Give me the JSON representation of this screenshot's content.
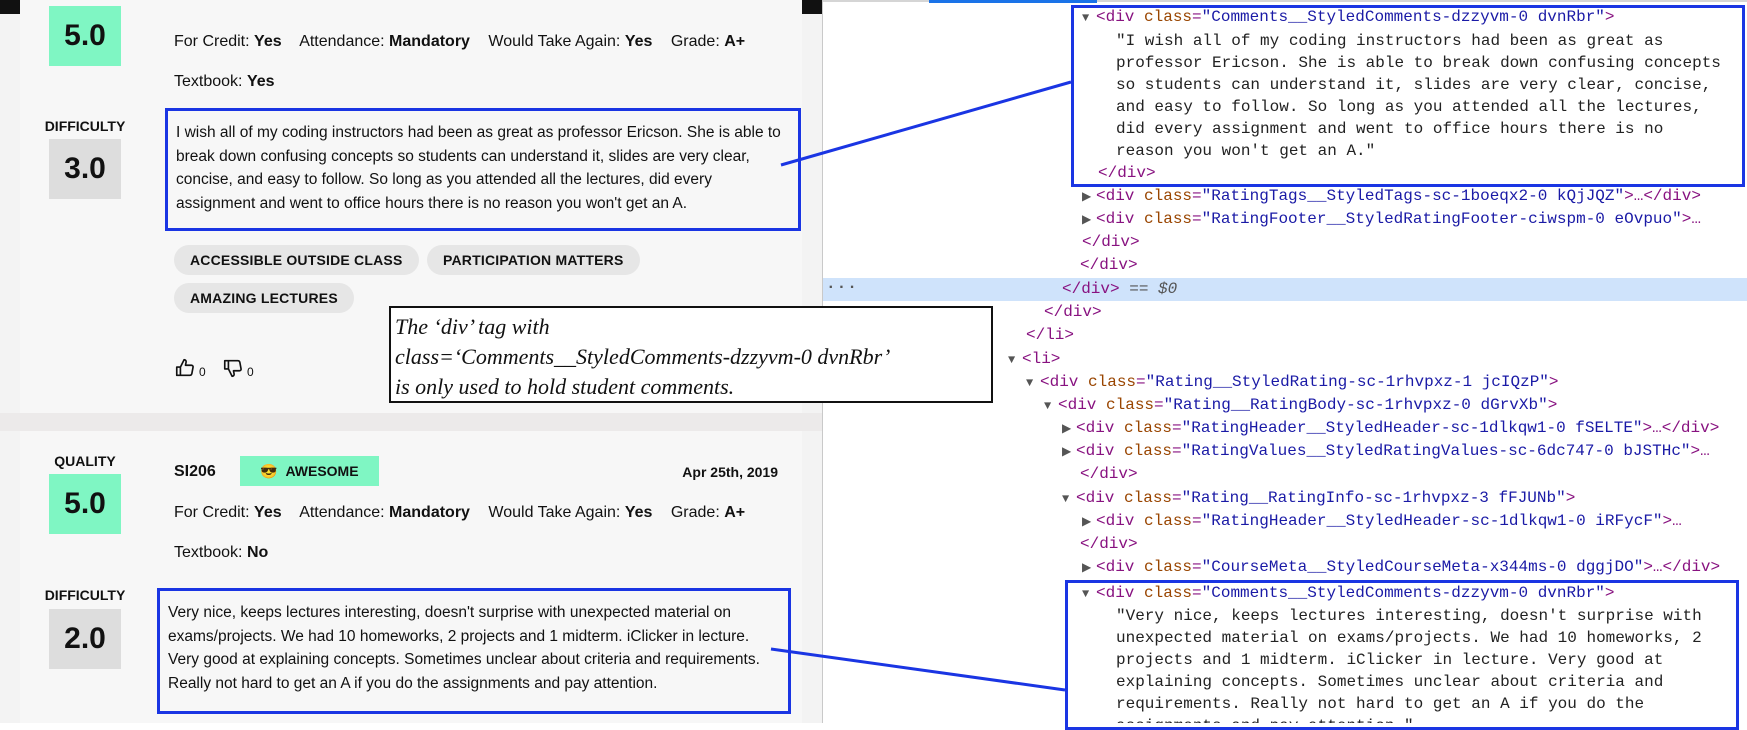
{
  "review1": {
    "quality_score": "5.0",
    "difficulty_label": "DIFFICULTY",
    "difficulty_score": "3.0",
    "meta": [
      {
        "label": "For Credit:",
        "value": "Yes"
      },
      {
        "label": "Attendance:",
        "value": "Mandatory"
      },
      {
        "label": "Would Take Again:",
        "value": "Yes"
      },
      {
        "label": "Grade:",
        "value": "A+"
      }
    ],
    "textbook_label": "Textbook:",
    "textbook_value": "Yes",
    "comment": "I wish all of my coding instructors had been as great as professor Ericson. She is able to break down confusing concepts so students can understand it, slides are very clear, concise, and easy to follow. So long as you attended all the lectures, did every assignment and went to office hours there is no reason you won't get an A.",
    "tags": [
      "ACCESSIBLE OUTSIDE CLASS",
      "PARTICIPATION MATTERS",
      "AMAZING LECTURES"
    ],
    "thumbs_up": "0",
    "thumbs_down": "0"
  },
  "review2": {
    "quality_label": "QUALITY",
    "quality_score": "5.0",
    "course": "SI206",
    "badge_emoji": "😎",
    "badge": "AWESOME",
    "date": "Apr 25th, 2019",
    "difficulty_label": "DIFFICULTY",
    "difficulty_score": "2.0",
    "meta": [
      {
        "label": "For Credit:",
        "value": "Yes"
      },
      {
        "label": "Attendance:",
        "value": "Mandatory"
      },
      {
        "label": "Would Take Again:",
        "value": "Yes"
      },
      {
        "label": "Grade:",
        "value": "A+"
      }
    ],
    "textbook_label": "Textbook:",
    "textbook_value": "No",
    "comment": "Very nice, keeps lectures interesting, doesn't surprise with unexpected material on exams/projects. We had 10 homeworks, 2 projects and 1 midterm. iClicker in lecture. Very good at explaining concepts. Sometimes unclear about criteria and requirements. Really not hard to get an A if you do the assignments and pay attention."
  },
  "annotation": {
    "line1": "The ‘div’ tag with",
    "line2": "class=‘Comments__StyledComments-dzzyvm-0 dvnRbr’",
    "line3": "is only used to hold student comments."
  },
  "devtools": {
    "comment1_text": "\"I wish all of my coding instructors had been as great as\nprofessor Ericson. She is able to break down confusing concepts\nso students can understand it, slides are very clear, concise,\nand easy to follow. So long as you attended all the lectures,\ndid every assignment and went to office hours there is no\nreason you won't get an A.\"",
    "comment2_text": "\"Very nice, keeps lectures interesting, doesn't surprise with\nunexpected material on exams/projects. We had 10 homeworks, 2\nprojects and 1 midterm. iClicker in lecture. Very good at\nexplaining concepts. Sometimes unclear about criteria and\nrequirements. Really not hard to get an A if you do the\nassignments and pay attention.\"",
    "selected_suffix": " == $0",
    "dots": "···",
    "tags": {
      "div_open": "<div",
      "div_close": "</div>",
      "li_open": "<li>",
      "li_close": "</li>",
      "gt": ">",
      "ellipsis_close": ">…</div>",
      "ellipsis_gt": ">…"
    },
    "attr_class": "class",
    "classes": {
      "comments": "\"Comments__StyledComments-dzzyvm-0 dvnRbr\"",
      "rating_tags": "\"RatingTags__StyledTags-sc-1boeqx2-0 kQjJQZ\"",
      "rating_footer": "\"RatingFooter__StyledRatingFooter-ciwspm-0 eOvpuo\"",
      "rating": "\"Rating__StyledRating-sc-1rhvpxz-1 jcIQzP\"",
      "rating_body": "\"Rating__RatingBody-sc-1rhvpxz-0 dGrvXb\"",
      "rating_header": "\"RatingHeader__StyledHeader-sc-1dlkqw1-0 fSELTE\"",
      "rating_values": "\"RatingValues__StyledRatingValues-sc-6dc747-0 bJSTHc\"",
      "rating_info": "\"Rating__RatingInfo-sc-1rhvpxz-3 fFJUNb\"",
      "rating_header2": "\"RatingHeader__StyledHeader-sc-1dlkqw1-0 iRFycF\"",
      "course_meta": "\"CourseMeta__StyledCourseMeta-x344ms-0 dggjDO\"",
      "comments2": "\"Comments__StyledComments-dzzyvm-0 dvnRbr\""
    }
  }
}
